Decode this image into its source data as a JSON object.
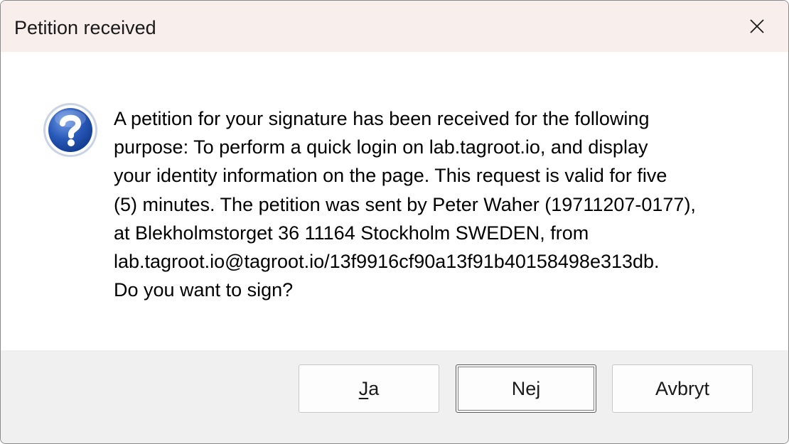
{
  "dialog": {
    "title": "Petition received",
    "message_lines": [
      "A petition for your signature has been received for the following",
      "purpose: To perform a quick login on lab.tagroot.io, and display",
      "your identity information on the page. This request is valid for five",
      "(5) minutes. The petition was sent by Peter Waher (19711207-0177),",
      "at Blekholmstorget 36 11164 Stockholm SWEDEN, from",
      "lab.tagroot.io@tagroot.io/13f9916cf90a13f91b40158498e313db.",
      "Do you want to sign?"
    ],
    "icon": "question-icon",
    "close_icon": "close-icon"
  },
  "buttons": {
    "yes": {
      "accel": "J",
      "rest": "a"
    },
    "no": {
      "pre": "Ne",
      "accel": "j",
      "rest": ""
    },
    "cancel": {
      "label": "Avbryt"
    }
  },
  "colors": {
    "titlebar": "#f8eeeb",
    "footer": "#f0f0f0",
    "icon_blue": "#1f4fa8"
  }
}
